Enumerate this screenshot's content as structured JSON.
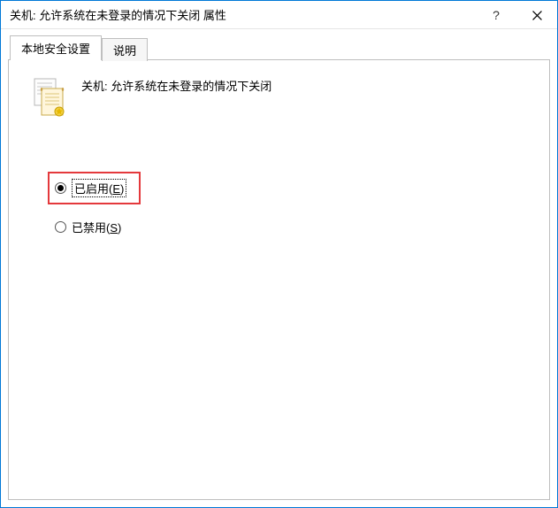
{
  "titlebar": {
    "title": "关机: 允许系统在未登录的情况下关闭 属性",
    "help_label": "?",
    "close_label": "✕"
  },
  "tabs": {
    "active": "本地安全设置",
    "inactive": "说明"
  },
  "policy": {
    "heading": "关机: 允许系统在未登录的情况下关闭"
  },
  "options": {
    "enabled_label": "已启用",
    "enabled_mnemonic": "E",
    "disabled_label": "已禁用",
    "disabled_mnemonic": "S",
    "selected": "enabled"
  }
}
